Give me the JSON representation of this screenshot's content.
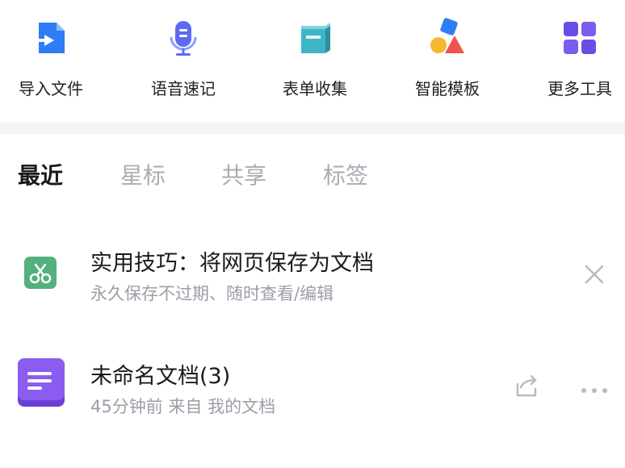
{
  "quick_actions": [
    {
      "label": "导入文件",
      "icon": "import-file-icon"
    },
    {
      "label": "语音速记",
      "icon": "microphone-icon"
    },
    {
      "label": "表单收集",
      "icon": "form-collect-icon"
    },
    {
      "label": "智能模板",
      "icon": "shapes-template-icon"
    },
    {
      "label": "更多工具",
      "icon": "grid-tools-icon"
    }
  ],
  "tabs": [
    {
      "label": "最近",
      "active": true
    },
    {
      "label": "星标",
      "active": false
    },
    {
      "label": "共享",
      "active": false
    },
    {
      "label": "标签",
      "active": false
    }
  ],
  "list": [
    {
      "title": "实用技巧：将网页保存为文档",
      "subtitle": "永久保存不过期、随时查看/编辑",
      "icon": "scissors-clip-icon",
      "actions": [
        "close-icon"
      ]
    },
    {
      "title": "未命名文档(3)",
      "subtitle": "45分钟前 来自 我的文档",
      "icon": "document-icon",
      "actions": [
        "share-icon",
        "more-icon"
      ]
    }
  ],
  "colors": {
    "blue": "#2f7cf6",
    "indigo": "#5b6cf0",
    "teal": "#3fb6c7",
    "yellow": "#f5b82e",
    "red": "#ef5350",
    "purple": "#7a4de6",
    "green": "#53b07f",
    "muted": "#a8acb3"
  }
}
